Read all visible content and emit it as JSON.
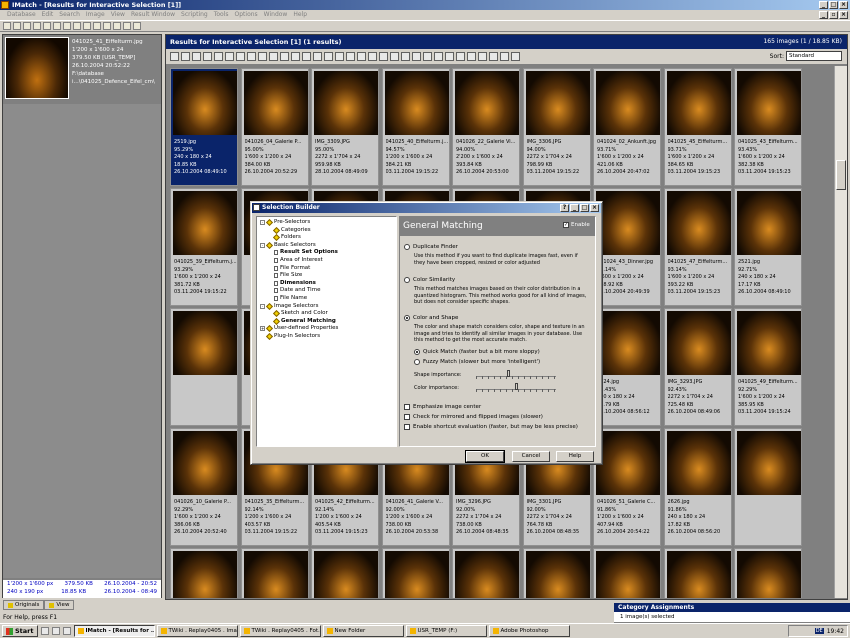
{
  "app": {
    "title": "IMatch - [Results for Interactive Selection [1]]",
    "menu": [
      "Database",
      "Edit",
      "Search",
      "Image",
      "View",
      "Result Window",
      "Scripting",
      "Tools",
      "Options",
      "Window",
      "Help"
    ]
  },
  "left_panel": {
    "info": [
      "041025_41_Eiffelturm.jpg",
      "1'200 x 1'600 x 24",
      "379.50 KB [USR_TEMP]",
      "26.10.2004 20:52:22",
      "F:\\database",
      "i...\\041025_Defence_Eifel_cm\\"
    ],
    "stats": [
      {
        "a": "1'200 x 1'600 px",
        "b": "379.50 KB",
        "c": "26.10.2004 - 20:52"
      },
      {
        "a": "240 x 190 px",
        "b": "18.85 KB",
        "c": "26.10.2004 - 08:49"
      }
    ],
    "tabs": [
      "Originals",
      "View"
    ]
  },
  "results": {
    "header": "Results for Interactive Selection [1] (1 results)",
    "count": "165 images (1 / 18.85 KB)",
    "sort_label": "Sort:",
    "sort_value": "Standard"
  },
  "thumbs": [
    {
      "name": "2519.jpg",
      "pct": "95.29%",
      "dims": "240 x 180 x 24",
      "size": "18.85 KB",
      "date": "26.10.2004 08:49:10",
      "sel": true
    },
    {
      "name": "041026_04_Galerie P...",
      "pct": "95.00%",
      "dims": "1'600 x 1'200 x 24",
      "size": "384.00 KB",
      "date": "26.10.2004 20:52:29"
    },
    {
      "name": "IMG_3309.JPG",
      "pct": "95.00%",
      "dims": "2272 x 1'704 x 24",
      "size": "959.98 KB",
      "date": "28.10.2004 08:49:09"
    },
    {
      "name": "041025_40_Eiffelturm.j...",
      "pct": "94.57%",
      "dims": "1'200 x 1'600 x 24",
      "size": "384.21 KB",
      "date": "03.11.2004 19:15:22"
    },
    {
      "name": "041026_22_Galerie Vi...",
      "pct": "94.00%",
      "dims": "2'200 x 1'600 x 24",
      "size": "393.84 KB",
      "date": "26.10.2004 20:53:00"
    },
    {
      "name": "IMG_3306.JPG",
      "pct": "94.00%",
      "dims": "2272 x 1'704 x 24",
      "size": "798.99 KB",
      "date": "03.11.2004 19:15:22"
    },
    {
      "name": "041024_02_Ankunft.jpg",
      "pct": "93.71%",
      "dims": "1'600 x 1'200 x 24",
      "size": "421.06 KB",
      "date": "26.10.2004 20:47:02"
    },
    {
      "name": "041025_45_Eiffelturm...",
      "pct": "93.71%",
      "dims": "1'600 x 1'200 x 24",
      "size": "384.65 KB",
      "date": "03.11.2004 19:15:23"
    },
    {
      "name": "041025_43_Eiffelturm...",
      "pct": "93.43%",
      "dims": "1'600 x 1'200 x 24",
      "size": "382.38 KB",
      "date": "03.11.2004 19:15:23"
    },
    {
      "name": "041025_39_Eiffelturm.j...",
      "pct": "93.29%",
      "dims": "1'600 x 1'200 x 24",
      "size": "381.72 KB",
      "date": "03.11.2004 19:15:22"
    },
    {
      "name": "",
      "pct": "",
      "dims": "",
      "size": "",
      "date": ""
    },
    {
      "name": "",
      "pct": "",
      "dims": "",
      "size": "",
      "date": ""
    },
    {
      "name": "",
      "pct": "",
      "dims": "",
      "size": "",
      "date": ""
    },
    {
      "name": "",
      "pct": "",
      "dims": "",
      "size": "",
      "date": ""
    },
    {
      "name": "2625.jpg",
      "pct": "",
      "dims": "180 x 24",
      "size": "KB",
      "date": "2004 08:56:16"
    },
    {
      "name": "041024_43_Dinner.jpg",
      "pct": "93.14%",
      "dims": "1'600 x 1'200 x 24",
      "size": "388.92 KB",
      "date": "26.10.2004 20:49:39"
    },
    {
      "name": "041025_47_Eiffelturm...",
      "pct": "93.14%",
      "dims": "1'600 x 1'200 x 24",
      "size": "393.22 KB",
      "date": "03.11.2004 19:15:23"
    },
    {
      "name": "2521.jpg",
      "pct": "92.71%",
      "dims": "240 x 180 x 24",
      "size": "17.17 KB",
      "date": "26.10.2004 08:49:10"
    },
    {
      "name": "",
      "pct": "",
      "dims": "",
      "size": "",
      "date": ""
    },
    {
      "name": "",
      "pct": "",
      "dims": "",
      "size": "",
      "date": ""
    },
    {
      "name": "",
      "pct": "",
      "dims": "",
      "size": "",
      "date": ""
    },
    {
      "name": "",
      "pct": "",
      "dims": "",
      "size": "",
      "date": ""
    },
    {
      "name": "",
      "pct": "",
      "dims": "",
      "size": "",
      "date": ""
    },
    {
      "name": "2518.jpg",
      "pct": "",
      "dims": "180 x 24",
      "size": "KB",
      "date": "2004 08:49:06"
    },
    {
      "name": "2624.jpg",
      "pct": "92.43%",
      "dims": "240 x 180 x 24",
      "size": "16.79 KB",
      "date": "26.10.2004 08:56:12"
    },
    {
      "name": "IMG_3293.JPG",
      "pct": "92.43%",
      "dims": "2272 x 1'704 x 24",
      "size": "725.48 KB",
      "date": "26.10.2004 08:49:06"
    },
    {
      "name": "041025_49_Eiffelturm...",
      "pct": "92.29%",
      "dims": "1'600 x 1'200 x 24",
      "size": "385.95 KB",
      "date": "03.11.2004 19:15:24"
    },
    {
      "name": "041026_10_Galerie P...",
      "pct": "92.29%",
      "dims": "1'600 x 1'200 x 24",
      "size": "386.06 KB",
      "date": "26.10.2004 20:52:40"
    },
    {
      "name": "041025_35_Eiffelturm...",
      "pct": "92.14%",
      "dims": "1'200 x 1'600 x 24",
      "size": "403.57 KB",
      "date": "03.11.2004 19:15:22"
    },
    {
      "name": "041025_42_Eiffelturm...",
      "pct": "92.14%",
      "dims": "1'200 x 1'600 x 24",
      "size": "405.54 KB",
      "date": "03.11.2004 19:15:23"
    },
    {
      "name": "041026_41_Galerie V...",
      "pct": "92.00%",
      "dims": "1'200 x 1'600 x 24",
      "size": "738.00 KB",
      "date": "26.10.2004 20:53:38"
    },
    {
      "name": "IMG_3296.JPG",
      "pct": "92.00%",
      "dims": "2272 x 1'704 x 24",
      "size": "738.00 KB",
      "date": "26.10.2004 08:48:35"
    },
    {
      "name": "IMG_3301.JPG",
      "pct": "92.00%",
      "dims": "2272 x 1'704 x 24",
      "size": "764.78 KB",
      "date": "26.10.2004 08:48:35"
    },
    {
      "name": "041026_51_Galerie C...",
      "pct": "91.86%",
      "dims": "1'200 x 1'600 x 24",
      "size": "407.94 KB",
      "date": "26.10.2004 20:54:22"
    },
    {
      "name": "2626.jpg",
      "pct": "91.86%",
      "dims": "240 x 180 x 24",
      "size": "17.82 KB",
      "date": "26.10.2004 08:56:20"
    }
  ],
  "dialog": {
    "title": "Selection Builder",
    "panel_title": "General Matching",
    "enable_label": "Enable",
    "tree": [
      {
        "label": "Pre-Selectors",
        "lvl": 0,
        "kind": "dia",
        "box": "-"
      },
      {
        "label": "Categories",
        "lvl": 1,
        "kind": "dia"
      },
      {
        "label": "Folders",
        "lvl": 1,
        "kind": "dia"
      },
      {
        "label": "Basic Selectors",
        "lvl": 0,
        "kind": "dia",
        "box": "-"
      },
      {
        "label": "Result Set Options",
        "lvl": 1,
        "kind": "doc",
        "bold": true
      },
      {
        "label": "Area of Interest",
        "lvl": 1,
        "kind": "doc"
      },
      {
        "label": "File Format",
        "lvl": 1,
        "kind": "doc"
      },
      {
        "label": "File Size",
        "lvl": 1,
        "kind": "doc"
      },
      {
        "label": "Dimensions",
        "lvl": 1,
        "kind": "doc",
        "bold": true
      },
      {
        "label": "Date and Time",
        "lvl": 1,
        "kind": "doc"
      },
      {
        "label": "File Name",
        "lvl": 1,
        "kind": "doc"
      },
      {
        "label": "Image Selectors",
        "lvl": 0,
        "kind": "dia",
        "box": "-"
      },
      {
        "label": "Sketch and Color",
        "lvl": 1,
        "kind": "dia"
      },
      {
        "label": "General Matching",
        "lvl": 1,
        "kind": "dia",
        "bold": true,
        "sel": true
      },
      {
        "label": "User-defined Properties",
        "lvl": 0,
        "kind": "dia",
        "box": "+"
      },
      {
        "label": "Plug-In Selectors",
        "lvl": 0,
        "kind": "dia"
      }
    ],
    "opt_duplicate": "Duplicate Finder",
    "desc_duplicate": "Use this method if you want to find duplicate images fast, even if they have been cropped, resized or color adjusted",
    "opt_color": "Color Similarity",
    "desc_color": "This method matches images based on their color distribution in a quantized histogram. This method works good for all kind of images, but does not consider specific shapes.",
    "opt_shape": "Color and Shape",
    "desc_shape": "The color and shape match considers color, shape and texture in an image and tries to identify all similar images in your database. Use this method to get the most accurate match.",
    "quick_match": "Quick Match (faster but a bit more sloppy)",
    "fuzzy_match": "Fuzzy Match (slower but more 'intelligent')",
    "shape_importance_label": "Shape importance:",
    "shape_importance_value": 0.4,
    "color_importance_label": "Color importance:",
    "color_importance_value": 0.5,
    "chk_center": "Emphasize image center",
    "chk_mirror": "Check for mirrored and flipped images (slower)",
    "chk_shortcut": "Enable shortcut evaluation (faster, but may be less precise)",
    "ok": "OK",
    "cancel": "Cancel",
    "help": "Help"
  },
  "category_panel": {
    "title": "Category Assignments",
    "sub": "1 image(s) selected"
  },
  "status": "For Help, press F1",
  "taskbar": {
    "start": "Start",
    "tasks": [
      "IMatch - [Results for ...",
      "TWiki . Replay0405 . Ima...",
      "TWiki . Replay0405 . Fot...",
      "New Folder",
      "USR_TEMP (F:)",
      "Adobe Photoshop"
    ],
    "lang": "DE",
    "time": "19:42"
  }
}
